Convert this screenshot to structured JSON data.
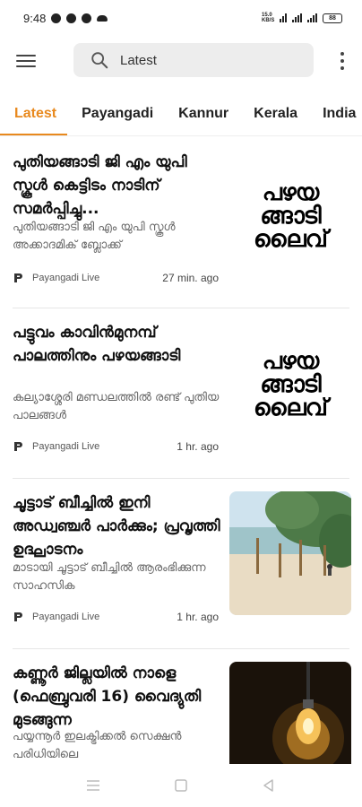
{
  "status_bar": {
    "time": "9:48",
    "network": "15.0 KB/S",
    "battery": "88"
  },
  "toolbar": {
    "search_text": "Latest"
  },
  "tabs": [
    {
      "label": "Latest",
      "active": true
    },
    {
      "label": "Payangadi",
      "active": false
    },
    {
      "label": "Kannur",
      "active": false
    },
    {
      "label": "Kerala",
      "active": false
    },
    {
      "label": "India",
      "active": false
    }
  ],
  "articles": [
    {
      "headline": "പുതിയങ്ങാടി ജി എം യുപി സ്കൂൾ കെട്ടിടം നാടിന് സമർപ്പിച്ചു...",
      "snippet": "പുതിയങ്ങാടി ജി എം യുപി സ്കൂൾ അക്കാദമിക് ബ്ലോക്ക്",
      "source": "Payangadi Live",
      "time": "27 min. ago",
      "thumb": "logo",
      "logo_lines": [
        "പഴയ",
        "ങ്ങാടി",
        "ലൈവ്"
      ]
    },
    {
      "headline": "പട്ടുവം കാവിൻമുനമ്പ് പാലത്തിനും പഴയങ്ങാടി",
      "snippet": "കല്യാശ്ശേരി മണ്ഡലത്തിൽ രണ്ട് പുതിയ പാലങ്ങൾ",
      "source": "Payangadi Live",
      "time": "1 hr. ago",
      "thumb": "logo",
      "logo_lines": [
        "പഴയ",
        "ങ്ങാടി",
        "ലൈവ്"
      ]
    },
    {
      "headline": "ചൂട്ടാട് ബീച്ചിൽ ഇനി അഡ്വഞ്ചർ പാർക്കും; പ്രവൃത്തി ഉദ്ഘാടനം",
      "snippet": "മാടായി ചൂട്ടാട് ബീച്ചിൽ ആരംഭിക്കുന്ന സാഹസിക",
      "source": "Payangadi Live",
      "time": "1 hr. ago",
      "thumb": "beach"
    },
    {
      "headline": "കണ്ണൂർ ജില്ലയിൽ നാളെ (ഫെബ്രുവരി 16) വൈദ്യുതി മുടങ്ങുന്ന",
      "snippet": "പയ്യന്നൂർ ഇലക്ട്രിക്കൽ സെക്ഷൻ പരിധിയിലെ",
      "source": "",
      "time": "",
      "thumb": "bulb"
    }
  ],
  "colors": {
    "accent": "#e8891e",
    "search_bg": "#ededed"
  }
}
